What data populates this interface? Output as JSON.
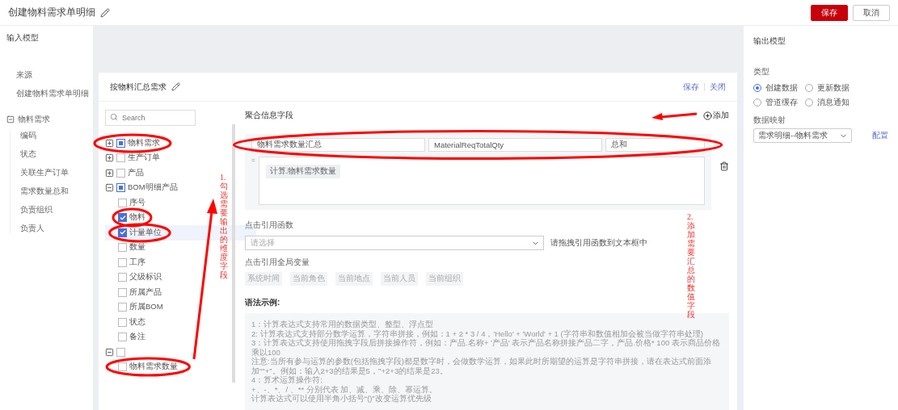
{
  "header": {
    "title": "创建物料需求单明细",
    "buttons": [
      {
        "label": "保存",
        "kind": "primary"
      },
      {
        "label": "取消",
        "kind": "default"
      }
    ]
  },
  "input_model": {
    "title": "输入模型",
    "source_label": "来源",
    "source": "创建物料需求单明细",
    "tree": [
      {
        "label": "物料需求",
        "expanded": true,
        "children": [
          {
            "label": "编码"
          },
          {
            "label": "状态"
          },
          {
            "label": "关联生产订单"
          },
          {
            "label": "需求数量总和"
          },
          {
            "label": "负责组织"
          },
          {
            "label": "负责人"
          }
        ]
      }
    ]
  },
  "editor": {
    "title": "按物料汇总需求",
    "actions": [
      "保存",
      "关闭"
    ],
    "search": {
      "placeholder": "Search"
    },
    "field_tree": [
      {
        "label": "物料需求",
        "expanded": false,
        "partial": true,
        "circled": true
      },
      {
        "label": "生产订单",
        "expanded": false,
        "checked": false,
        "circled": false
      },
      {
        "label": "产品",
        "expanded": false,
        "checked": false,
        "circled": false
      },
      {
        "label": "BOM明细产品",
        "expanded": true,
        "partial": true,
        "circled": false,
        "children": [
          {
            "label": "序号",
            "checked": false,
            "selected": false,
            "circled": false
          },
          {
            "label": "物料",
            "checked": true,
            "selected": false,
            "circled": true
          },
          {
            "label": "计量单位",
            "checked": true,
            "selected": true,
            "circled": true
          },
          {
            "label": "数量",
            "checked": false,
            "selected": false,
            "circled": false
          },
          {
            "label": "工序",
            "checked": false,
            "selected": false,
            "circled": false
          },
          {
            "label": "父级标识",
            "checked": false,
            "selected": false,
            "circled": false
          },
          {
            "label": "所属产品",
            "checked": false,
            "selected": false,
            "circled": false
          },
          {
            "label": "所属BOM",
            "checked": false,
            "selected": false,
            "circled": false
          },
          {
            "label": "状态",
            "checked": false,
            "selected": false,
            "circled": false
          },
          {
            "label": "备注",
            "checked": false,
            "selected": false,
            "circled": false
          }
        ]
      },
      {
        "expanded": true,
        "checked": false,
        "circled": false,
        "children": [
          {
            "label": "物料需求数量",
            "checked": false,
            "selected": false,
            "circled": true
          }
        ]
      }
    ],
    "aggregate": {
      "title": "聚合信息字段",
      "add": "添加",
      "fields": [
        {
          "name": "物料需求数量汇总",
          "code": "MaterialReqTotalQty",
          "method": "总和",
          "circled": true,
          "equals": "=",
          "tokens": [
            "计算.物料需求数量"
          ]
        }
      ]
    },
    "function_label": "点击引用函数",
    "function_select": {
      "placeholder": "请选择"
    },
    "function_hint": "请拖拽引用函数到文本框中",
    "globals_label": "点击引用全局变量",
    "globals": [
      "系统时间",
      "当前角色",
      "当前地点",
      "当前人员",
      "当前组织"
    ],
    "syntax_title": "语法示例:",
    "syntax_lines": [
      "1：计算表达式支持常用的数据类型、整型、浮点型",
      "2: 计算表达式支持部分数学运算，字符串拼接，例如：1 + 2 * 3 / 4，'Hello' + 'World' + 1 (字符串和数值相加会被当做字符串处理)",
      "3：计算表达式支持使用拖拽字段后拼接操作符，例如：产品.名称+ '产品' 表示产品名称拼接产品二字，产品.价格* 100 表示商品价格乘以100",
      "注意:当所有参与运算的参数(包括拖拽字段)都是数字时，会做数学运算，如果此时所期望的运算是字符串拼接，请在表达式前面添加“''+”。例如：输入2+3的结果是5，''+2+3的结果是23。",
      "4：算术运算操作符:",
      "+、-、*、/ 、** 分别代表 加、减、乘、除、幂运算。",
      "计算表达式可以使用半角小括号“()”改变运算优先级"
    ]
  },
  "output_model": {
    "title": "输出模型",
    "type_label": "类型",
    "types": [
      {
        "label": "创建数据",
        "selected": true
      },
      {
        "label": "更新数据",
        "selected": false
      },
      {
        "label": "管道缓存",
        "selected": false
      },
      {
        "label": "消息通知",
        "selected": false
      }
    ],
    "mapping_label": "数据映射",
    "mapping": "需求明细--物料需求",
    "configure": "配置"
  },
  "annotations": [
    {
      "kind": "vertical",
      "text": "1.勾选需要输出的维度字段"
    },
    {
      "kind": "vertical",
      "text": "2.添加需要汇总的数值字段"
    }
  ]
}
